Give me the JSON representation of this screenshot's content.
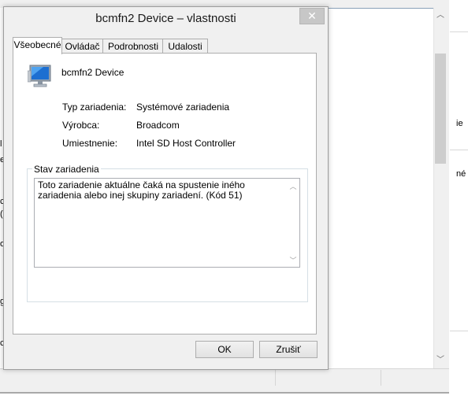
{
  "dialog": {
    "title": "bcmfn2 Device – vlastnosti",
    "close_glyph": "✕",
    "tabs": [
      {
        "label": "Všeobecné",
        "active": true
      },
      {
        "label": "Ovládač",
        "active": false
      },
      {
        "label": "Podrobnosti",
        "active": false
      },
      {
        "label": "Udalosti",
        "active": false
      }
    ],
    "device": {
      "icon": "computer-monitor-icon",
      "name": "bcmfn2 Device"
    },
    "properties": [
      {
        "label": "Typ zariadenia:",
        "value": "Systémové zariadenia"
      },
      {
        "label": "Výrobca:",
        "value": "Broadcom"
      },
      {
        "label": "Umiestnenie:",
        "value": "Intel SD Host Controller"
      }
    ],
    "status_group": {
      "legend": "Stav zariadenia",
      "text": "Toto zariadenie aktuálne čaká na spustenie iného zariadenia alebo inej skupiny zariadení. (Kód 51)"
    },
    "buttons": {
      "ok": "OK",
      "cancel": "Zrušiť"
    }
  },
  "background_window": {
    "fragments_right": [
      "ie",
      "né"
    ],
    "fragments_left": [
      "l",
      "e",
      "c",
      "(",
      "o",
      "g",
      "c"
    ]
  },
  "colors": {
    "dialog_bg": "#f0f0f0",
    "panel_bg": "#ffffff",
    "close_button": "#c7c7c7",
    "border": "#adadad"
  }
}
